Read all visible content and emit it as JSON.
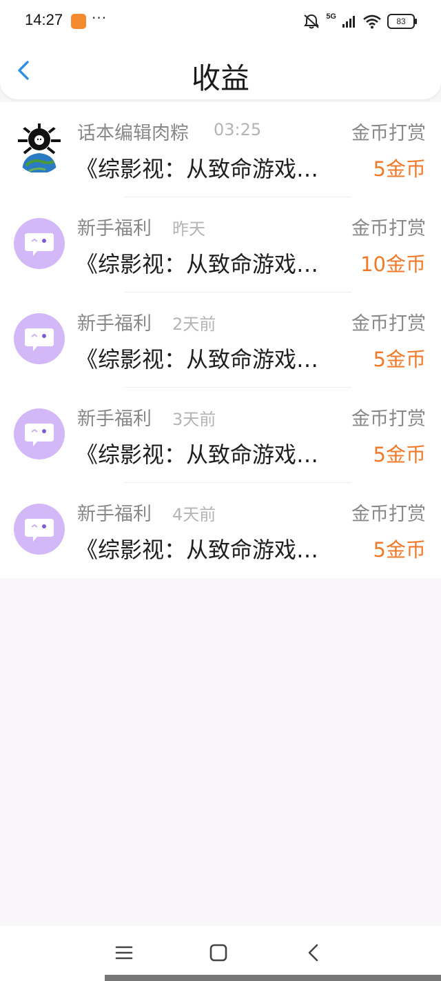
{
  "status_bar": {
    "time": "14:27",
    "dots": "···",
    "network": "5G",
    "battery": "83",
    "icons": [
      "app-notification-icon",
      "mute-icon",
      "signal-icon",
      "wifi-icon",
      "battery-icon"
    ]
  },
  "header": {
    "title": "收益",
    "back_icon": "chevron-left-icon"
  },
  "items": [
    {
      "name": "话本编辑肉粽",
      "time": "03:25",
      "type": "金币打赏",
      "work": "《综影视：从致命游戏…",
      "amount": "5金币",
      "avatar": "custom-avatar"
    },
    {
      "name": "新手福利",
      "time": "昨天",
      "type": "金币打赏",
      "work": "《综影视：从致命游戏…",
      "amount": "10金币",
      "avatar": "chat-bubble-avatar"
    },
    {
      "name": "新手福利",
      "time": "2天前",
      "type": "金币打赏",
      "work": "《综影视：从致命游戏…",
      "amount": "5金币",
      "avatar": "chat-bubble-avatar"
    },
    {
      "name": "新手福利",
      "time": "3天前",
      "type": "金币打赏",
      "work": "《综影视：从致命游戏…",
      "amount": "5金币",
      "avatar": "chat-bubble-avatar"
    },
    {
      "name": "新手福利",
      "time": "4天前",
      "type": "金币打赏",
      "work": "《综影视：从致命游戏…",
      "amount": "5金币",
      "avatar": "chat-bubble-avatar"
    }
  ],
  "nav": {
    "icons": [
      "menu-icon",
      "home-square-icon",
      "back-triangle-icon"
    ]
  },
  "colors": {
    "accent_amount": "#f07a2a",
    "back_arrow": "#2f8fe8",
    "avatar_purple": "#d3b8f8"
  }
}
